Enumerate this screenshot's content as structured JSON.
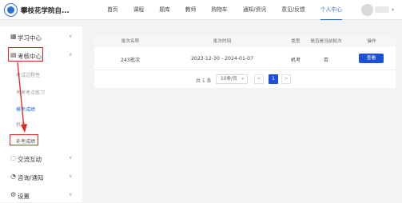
{
  "header": {
    "brand": "攀枝花学院自...",
    "nav": [
      "首页",
      "课程",
      "题库",
      "教师",
      "购物车",
      "通知/资讯",
      "意见/反馈",
      "个人中心"
    ],
    "active_nav": "个人中心"
  },
  "sidebar": {
    "menus": {
      "learning": {
        "icon": "grid-icon",
        "label": "学习中心"
      },
      "exam": {
        "icon": "exam-doc-icon",
        "label": "考核中心"
      },
      "interaction": {
        "icon": "chat-icon",
        "label": "交流互动"
      },
      "notice": {
        "icon": "bell-icon",
        "label": "咨询/通知"
      },
      "settings": {
        "icon": "gear-icon",
        "label": "设置"
      }
    },
    "exam_subitems": [
      "考试过程性",
      "考考考点练习",
      "模考成绩",
      "机考",
      "补考成绩"
    ],
    "active_subitem": "模考成绩"
  },
  "table": {
    "headers": [
      "批次名称",
      "批次时间",
      "类型",
      "是否是当前批次",
      "操作"
    ],
    "rows": [
      {
        "name": "243批次",
        "time": "2023-12-30 - 2024-01-07",
        "type": "机考",
        "current": "否",
        "action": "查看"
      }
    ]
  },
  "pagination": {
    "total": "共 1 条",
    "page_size": "10条/页",
    "prev": "<",
    "current": "1",
    "next": ">"
  },
  "colors": {
    "accent": "#1f4fd8",
    "highlight": "#e1261c"
  }
}
